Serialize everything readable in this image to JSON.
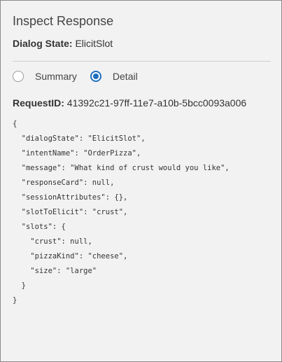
{
  "panel": {
    "title": "Inspect Response",
    "dialog_state_label": "Dialog State:",
    "dialog_state_value": "ElicitSlot"
  },
  "view_toggle": {
    "options": [
      {
        "label": "Summary",
        "selected": false
      },
      {
        "label": "Detail",
        "selected": true
      }
    ]
  },
  "request": {
    "id_label": "RequestID:",
    "id_value": "41392c21-97ff-11e7-a10b-5bcc0093a006"
  },
  "response_json": {
    "lines": [
      "{",
      "  \"dialogState\": \"ElicitSlot\",",
      "  \"intentName\": \"OrderPizza\",",
      "  \"message\": \"What kind of crust would you like\",",
      "  \"responseCard\": null,",
      "  \"sessionAttributes\": {},",
      "  \"slotToElicit\": \"crust\",",
      "  \"slots\": {",
      "    \"crust\": null,",
      "    \"pizzaKind\": \"cheese\",",
      "    \"size\": \"large\"",
      "  }",
      "}"
    ]
  },
  "colors": {
    "background": "#f2f2f2",
    "accent": "#1f6fbf",
    "border": "#8a8a8a"
  }
}
